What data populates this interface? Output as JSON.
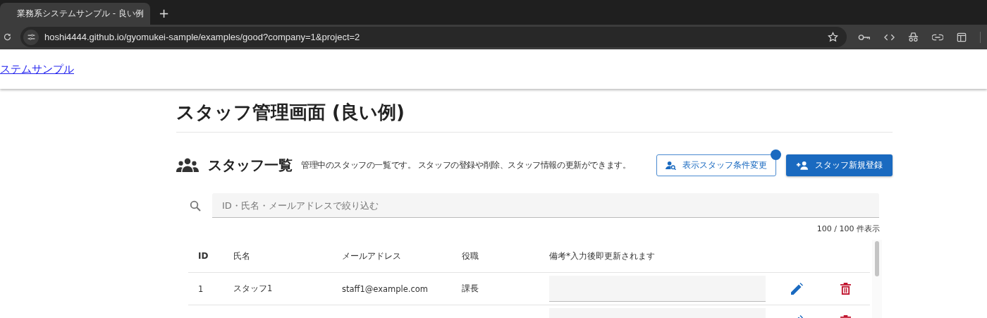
{
  "browser": {
    "tab_title": "業務系システムサンプル - 良い例",
    "new_tab": "+",
    "url": "hoshi4444.github.io/gyomukei-sample/examples/good?company=1&project=2"
  },
  "header": {
    "link": "ステムサンプル"
  },
  "page_title": "スタッフ管理画面 (良い例)",
  "section": {
    "title": "スタッフ一覧",
    "description": "管理中のスタッフの一覧です。 スタッフの登録や削除、スタッフ情報の更新ができます。"
  },
  "buttons": [
    {
      "label": "表示スタッフ条件変更",
      "kind": "outlined",
      "badge": true
    },
    {
      "label": "スタッフ新規登録",
      "kind": "filled",
      "badge": false
    }
  ],
  "search": {
    "placeholder": "ID・氏名・メールアドレスで絞り込む"
  },
  "count": "100 / 100 件表示",
  "table": {
    "columns": [
      {
        "label": "ID"
      },
      {
        "label": "氏名"
      },
      {
        "label": "メールアドレス"
      },
      {
        "label": "役職"
      },
      {
        "label": "備考",
        "note": "*入力後即更新されます"
      }
    ],
    "rows": [
      {
        "kind": "full",
        "id": "1",
        "name": "スタッフ1",
        "email": "staff1@example.com",
        "role": "課長"
      },
      {
        "kind": "partial"
      }
    ]
  }
}
